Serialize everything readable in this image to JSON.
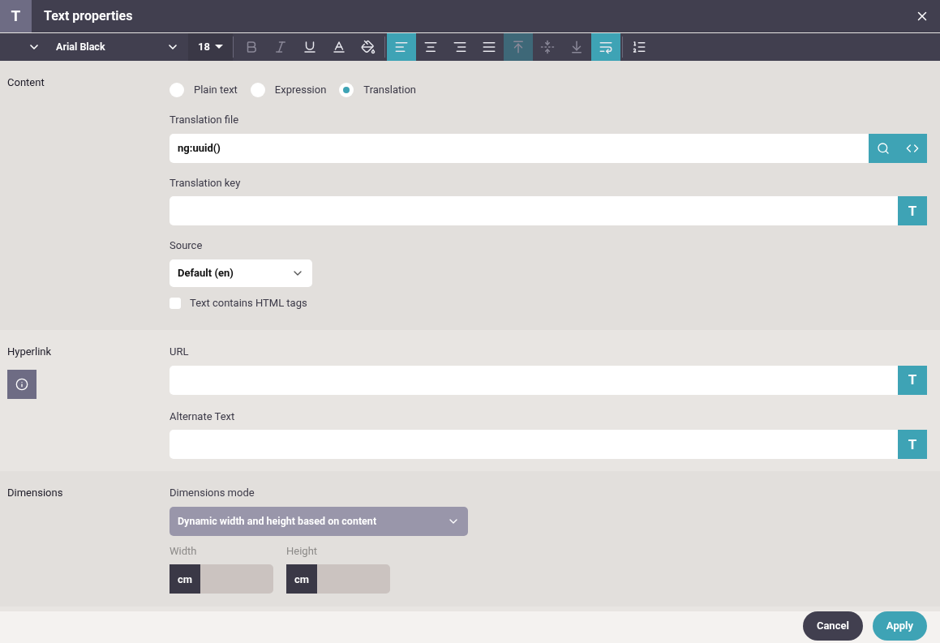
{
  "window": {
    "logo": "T",
    "title": "Text properties"
  },
  "toolbar": {
    "font": "Arial Black",
    "size": "18",
    "tools": [
      {
        "kind": "bold",
        "selected": false,
        "disabled": true
      },
      {
        "kind": "italic",
        "selected": false,
        "disabled": true
      },
      {
        "kind": "underline",
        "selected": false,
        "disabled": false
      },
      {
        "kind": "font-color",
        "selected": false,
        "disabled": false
      },
      {
        "kind": "fill",
        "selected": false,
        "disabled": false
      },
      {
        "kind": "align-left",
        "selected": true,
        "disabled": false
      },
      {
        "kind": "align-center",
        "selected": false,
        "disabled": false
      },
      {
        "kind": "align-right",
        "selected": false,
        "disabled": false
      },
      {
        "kind": "justify",
        "selected": false,
        "disabled": false
      },
      {
        "kind": "valign-top",
        "selected": true,
        "disabled": true
      },
      {
        "kind": "valign-middle",
        "selected": false,
        "disabled": true
      },
      {
        "kind": "valign-bottom",
        "selected": false,
        "disabled": true
      },
      {
        "kind": "wrap",
        "selected": true,
        "disabled": false
      },
      {
        "kind": "line-height",
        "selected": false,
        "disabled": false
      }
    ]
  },
  "content": {
    "label": "Content",
    "modes": [
      {
        "label": "Plain text",
        "selected": false
      },
      {
        "label": "Expression",
        "selected": false
      },
      {
        "label": "Translation",
        "selected": true
      }
    ],
    "translation_file": {
      "label": "Translation file",
      "value": "ng:uuid()"
    },
    "translation_key": {
      "label": "Translation key",
      "button": "T"
    },
    "source": {
      "label": "Source",
      "value": "Default (en)"
    },
    "html_tags": {
      "label": "Text contains HTML tags",
      "checked": false
    }
  },
  "hyperlink": {
    "label": "Hyperlink",
    "url": {
      "label": "URL",
      "button": "T"
    },
    "alternate_text": {
      "label": "Alternate Text",
      "button": "T"
    }
  },
  "dimensions": {
    "label": "Dimensions",
    "mode": {
      "label": "Dimensions mode",
      "value": "Dynamic width and height based on content"
    },
    "width": {
      "label": "Width",
      "unit": "cm"
    },
    "height": {
      "label": "Height",
      "unit": "cm"
    }
  },
  "buttons": [
    {
      "kind": "cancel",
      "label": "Cancel"
    },
    {
      "kind": "apply",
      "label": "Apply"
    }
  ]
}
